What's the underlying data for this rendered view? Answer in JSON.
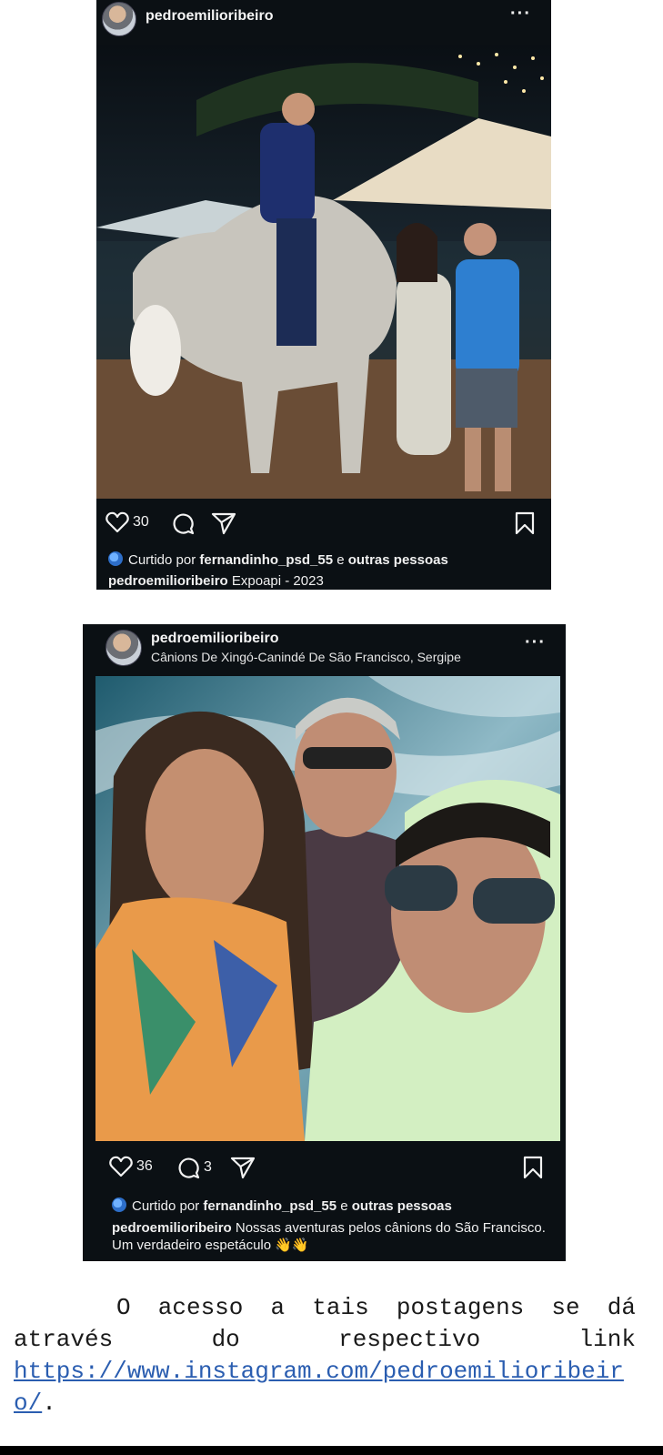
{
  "post1": {
    "username": "pedroemilioribeiro",
    "more": "···",
    "likes_count": "30",
    "liked_by_prefix": "Curtido por",
    "liked_by_user": "fernandinho_psd_55",
    "liked_by_and": "e",
    "liked_by_others": "outras pessoas",
    "caption_user": "pedroemilioribeiro",
    "caption_text": "Expoapi - 2023"
  },
  "post2": {
    "username": "pedroemilioribeiro",
    "location": "Cânions De Xingó-Canindé De São Francisco, Sergipe",
    "more": "···",
    "likes_count": "36",
    "comments_count": "3",
    "liked_by_prefix": "Curtido por",
    "liked_by_user": "fernandinho_psd_55",
    "liked_by_and": "e",
    "liked_by_others": "outras pessoas",
    "caption_user": "pedroemilioribeiro",
    "caption_text": "Nossas aventuras pelos cânions do São Francisco. Um verdadeiro espetáculo 👋👋"
  },
  "document": {
    "line1": "O acesso a tais postagens se dá",
    "line2_words": [
      "através",
      "do",
      "respectivo",
      "link"
    ],
    "link": "https://www.instagram.com/pedroemilioribeiro/",
    "suffix": "."
  },
  "colors": {
    "post_bg": "#0b1014",
    "link": "#2a5db0"
  }
}
